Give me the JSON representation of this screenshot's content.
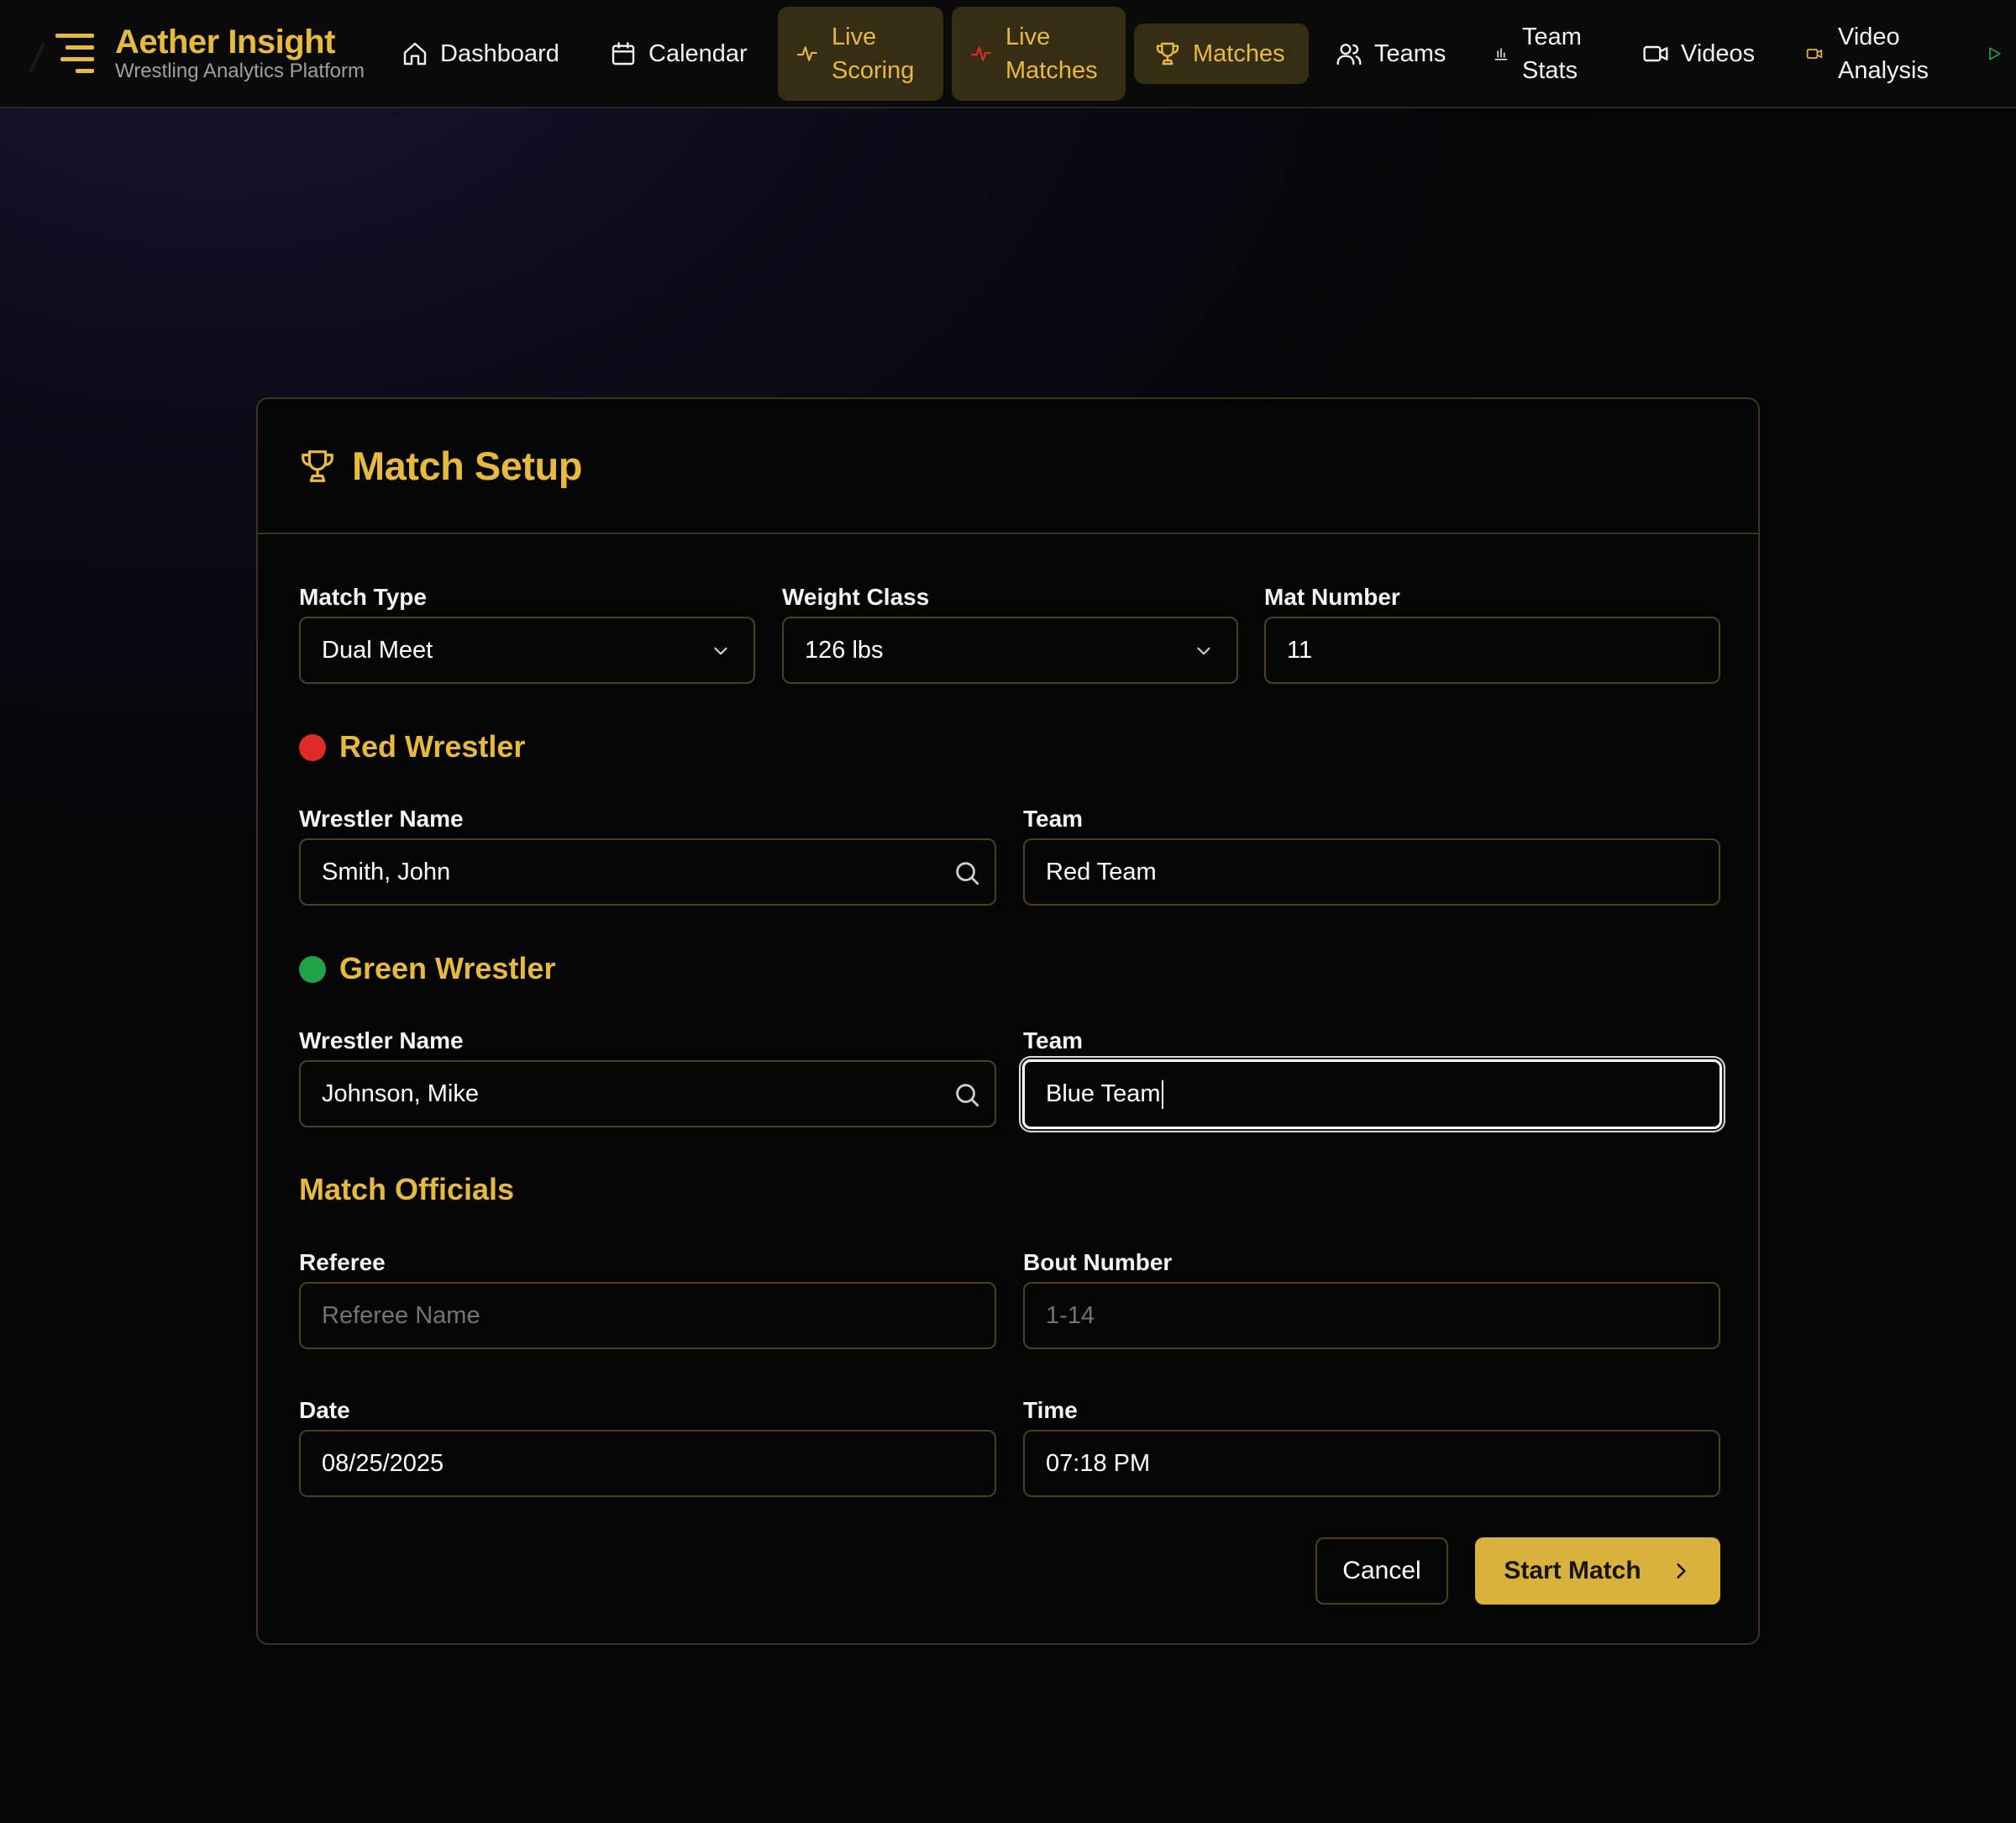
{
  "brand": {
    "title": "Aether Insight",
    "subtitle": "Wrestling Analytics Platform"
  },
  "nav": {
    "dashboard": "Dashboard",
    "calendar": "Calendar",
    "live_scoring_1": "Live",
    "live_scoring_2": "Scoring",
    "live_matches_1": "Live",
    "live_matches_2": "Matches",
    "matches": "Matches",
    "teams": "Teams",
    "team_stats_1": "Team",
    "team_stats_2": "Stats",
    "videos": "Videos",
    "video_analysis_1": "Video",
    "video_analysis_2": "Analysis"
  },
  "card": {
    "title": "Match Setup"
  },
  "match": {
    "type_label": "Match Type",
    "type_value": "Dual Meet",
    "weight_label": "Weight Class",
    "weight_value": "126 lbs",
    "mat_label": "Mat Number",
    "mat_value": "11"
  },
  "red": {
    "section": "Red Wrestler",
    "name_label": "Wrestler Name",
    "name_value": "Smith, John",
    "team_label": "Team",
    "team_value": "Red Team"
  },
  "green": {
    "section": "Green Wrestler",
    "name_label": "Wrestler Name",
    "name_value": "Johnson, Mike",
    "team_label": "Team",
    "team_value": "Blue Team"
  },
  "officials": {
    "section": "Match Officials",
    "referee_label": "Referee",
    "referee_placeholder": "Referee Name",
    "bout_label": "Bout Number",
    "bout_placeholder": "1-14",
    "date_label": "Date",
    "date_value": "08/25/2025",
    "time_label": "Time",
    "time_value": "07:18 PM"
  },
  "actions": {
    "cancel": "Cancel",
    "start": "Start Match"
  },
  "colors": {
    "accent": "#e7b93c",
    "red_dot": "#e12b2b",
    "green_dot": "#1fa34a",
    "active_bg": "#362d15"
  },
  "icons": {
    "dashboard": "home-icon",
    "calendar": "calendar-icon",
    "live_scoring": "activity-icon",
    "live_matches": "activity-icon",
    "matches": "trophy-icon",
    "teams": "users-icon",
    "team_stats": "bar-chart-icon",
    "videos": "video-icon",
    "video_analysis": "video-icon",
    "more": "play-icon"
  }
}
